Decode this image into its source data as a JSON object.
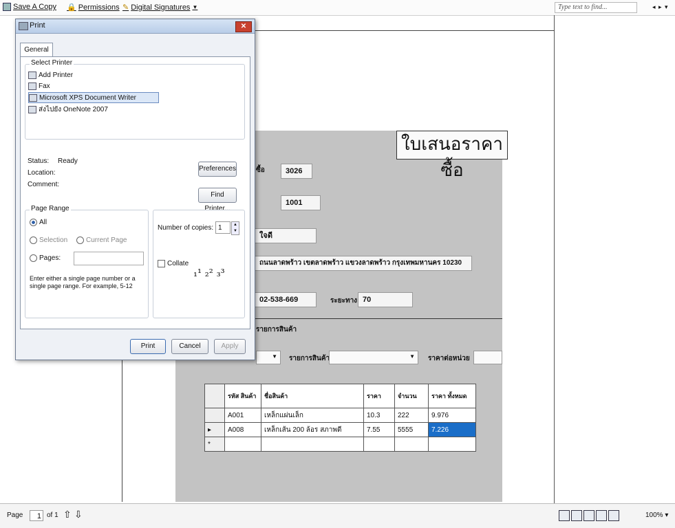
{
  "toolbar": {
    "save_copy": "Save A Copy",
    "permissions": "Permissions",
    "digital_signatures": "Digital Signatures",
    "find_placeholder": "Type text to find..."
  },
  "form": {
    "title": "ใบเสนอราคาซื้อ",
    "code_label": "ซื้อ",
    "code_value": "3026",
    "id_value": "1001",
    "name_label": "ใจดี",
    "address": "ถนนลาดพร้าว เขตลาดพร้าว แขวงลาดพร้าว กรุงเทพมหานคร 10230",
    "phone": "02-538-669",
    "distance_label": "ระยะทาง",
    "distance_value": "70",
    "section_label": "รายการสินค้า",
    "product_list_label": "รายการสินค้า",
    "unit_price_label": "ราคาต่อหน่วย"
  },
  "grid": {
    "headers": [
      "รหัส สินค้า",
      "ชื่อสินค้า",
      "ราคา",
      "จำนวน",
      "ราคา ทั้งหมด"
    ],
    "rows": [
      [
        "A001",
        "เหล็กแผ่นเล็ก",
        "10.3",
        "222",
        "9.976"
      ],
      [
        "A008",
        "เหล็กเส้น 200 ล้อร สภาพดี",
        "7.55",
        "5555",
        "7.226"
      ]
    ],
    "new_row_marker": "*",
    "current_row_marker": "▸"
  },
  "dialog": {
    "title": "Print",
    "close": "✕",
    "tab": "General",
    "select_printer": "Select Printer",
    "printers": [
      "Add Printer",
      "Fax",
      "Microsoft XPS Document Writer",
      "ส่งไปยัง OneNote 2007"
    ],
    "status_label": "Status:",
    "status_value": "Ready",
    "location_label": "Location:",
    "comment_label": "Comment:",
    "preferences": "Preferences",
    "find_printer": "Find Printer...",
    "page_range": "Page Range",
    "all": "All",
    "selection": "Selection",
    "current_page": "Current Page",
    "pages": "Pages:",
    "hint": "Enter either a single page number or a single page range.  For example, 5-12",
    "copies_label": "Number of copies:",
    "copies_value": "1",
    "collate": "Collate",
    "print": "Print",
    "cancel": "Cancel",
    "apply": "Apply"
  },
  "bottom": {
    "page_label": "Page",
    "page_value": "1",
    "of_label": "of 1",
    "zoom": "100%"
  },
  "colors": {
    "selection": "#1a6ec8",
    "form_bg": "#c3c3c3",
    "close": "#c8412e"
  }
}
